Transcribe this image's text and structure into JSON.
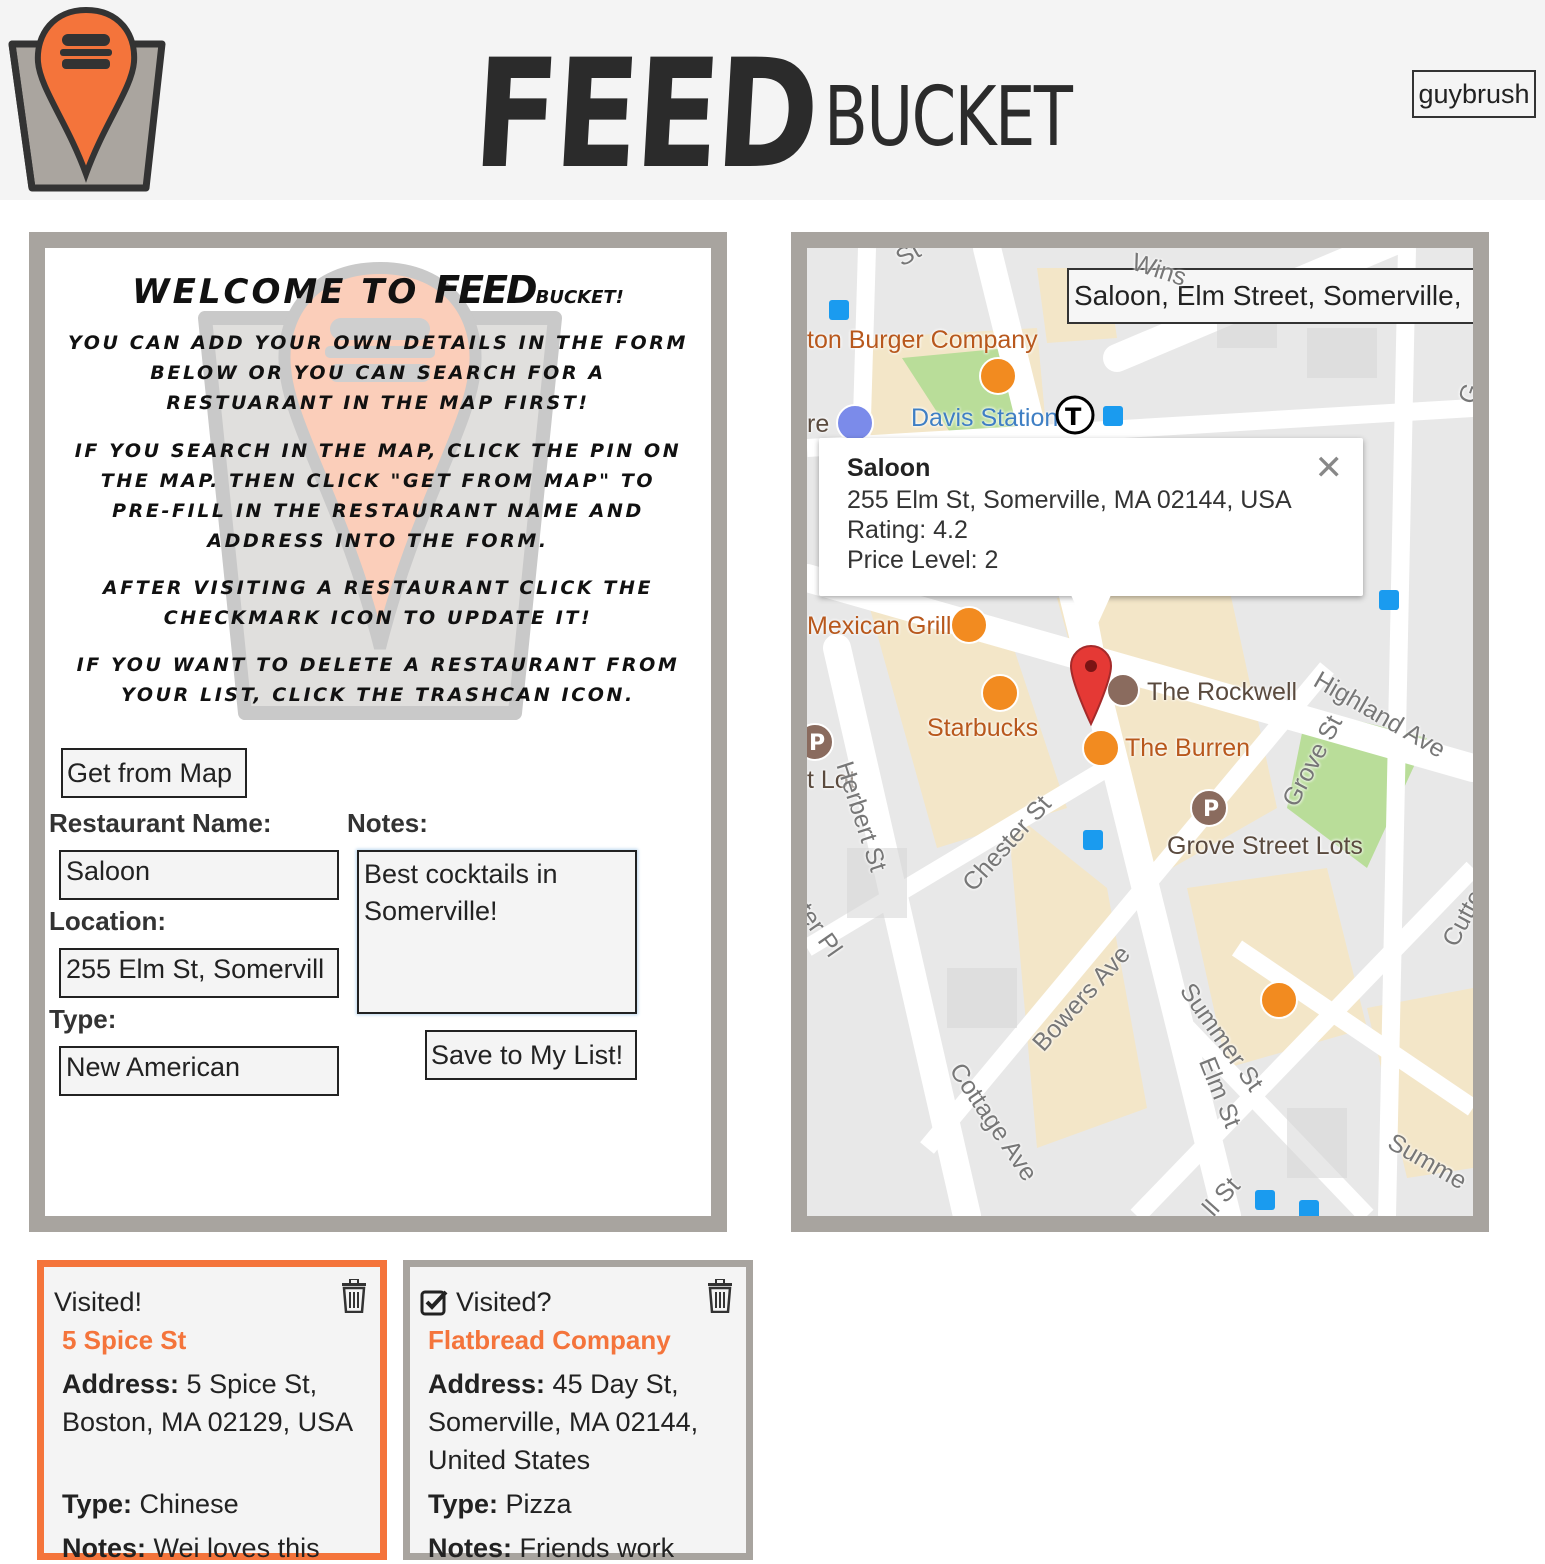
{
  "header": {
    "brand_main": "FEED",
    "brand_sub": "BUCKET",
    "user_button": "guybrush"
  },
  "welcome": {
    "title_prefix": "WELCOME TO",
    "title_brand_main": "FEED",
    "title_brand_sub": "BUCKET!",
    "p1": "You can add your own details in the form below or you can search for a restuarant in the map first!",
    "p2": "If you search in the map, click the pin on the map. Then click \"Get From Map\" to pre-fill in the restaurant name and address into the form.",
    "p3": "After visiting a restaurant click the checkmark icon to update it!",
    "p4": "If you want to delete a restaurant from your list, click the trashcan icon."
  },
  "form": {
    "get_from_map": "Get from Map",
    "name_label": "Restaurant Name:",
    "name_value": "Saloon",
    "location_label": "Location:",
    "location_value": "255 Elm St, Somervill",
    "type_label": "Type:",
    "type_value": "New American",
    "notes_label": "Notes:",
    "notes_value": "Best cocktails in Somerville!",
    "save_button": "Save to My List!"
  },
  "map": {
    "search_value": "Saloon, Elm Street, Somerville,",
    "labels": {
      "burger": "ton Burger Company",
      "davis": "Davis Station",
      "re": "re",
      "mexican": "Mexican Grill",
      "starbucks": "Starbucks",
      "rockwell": "The Rockwell",
      "burren": "The Burren",
      "lot": "t Lot",
      "grove_lots": "Grove Street Lots"
    },
    "streets": {
      "herbert": "Herbert St",
      "chester": "Chester St",
      "grove": "Grove St",
      "highland": "Highland Ave",
      "bowers": "Bowers Ave",
      "summer": "Summer St",
      "elm": "Elm St",
      "cottage": "Cottage Ave",
      "summe": "Summe",
      "cutte": "Cutte",
      "ster_pl": "ster Pl",
      "ll_st": "ll St",
      "wins": "Wins",
      "st": "St",
      "g": "G"
    },
    "info": {
      "title": "Saloon",
      "address": "255 Elm St, Somerville, MA 02144, USA",
      "rating": "Rating: 4.2",
      "price": "Price Level: 2"
    }
  },
  "cards": [
    {
      "visited": "Visited!",
      "name": "5 Spice St",
      "address_label": "Address:",
      "address": "5 Spice St, Boston, MA 02129, USA",
      "type_label": "Type:",
      "type": "Chinese",
      "notes_label": "Notes:",
      "notes": "Wei loves this"
    },
    {
      "visited": "Visited?",
      "name": "Flatbread Company",
      "address_label": "Address:",
      "address": "45 Day St, Somerville, MA 02144, United States",
      "type_label": "Type:",
      "type": "Pizza",
      "notes_label": "Notes:",
      "notes": "Friends work"
    }
  ],
  "colors": {
    "accent": "#f4743b",
    "panel_border": "#a8a49f",
    "header_bg": "#f4f4f4"
  }
}
